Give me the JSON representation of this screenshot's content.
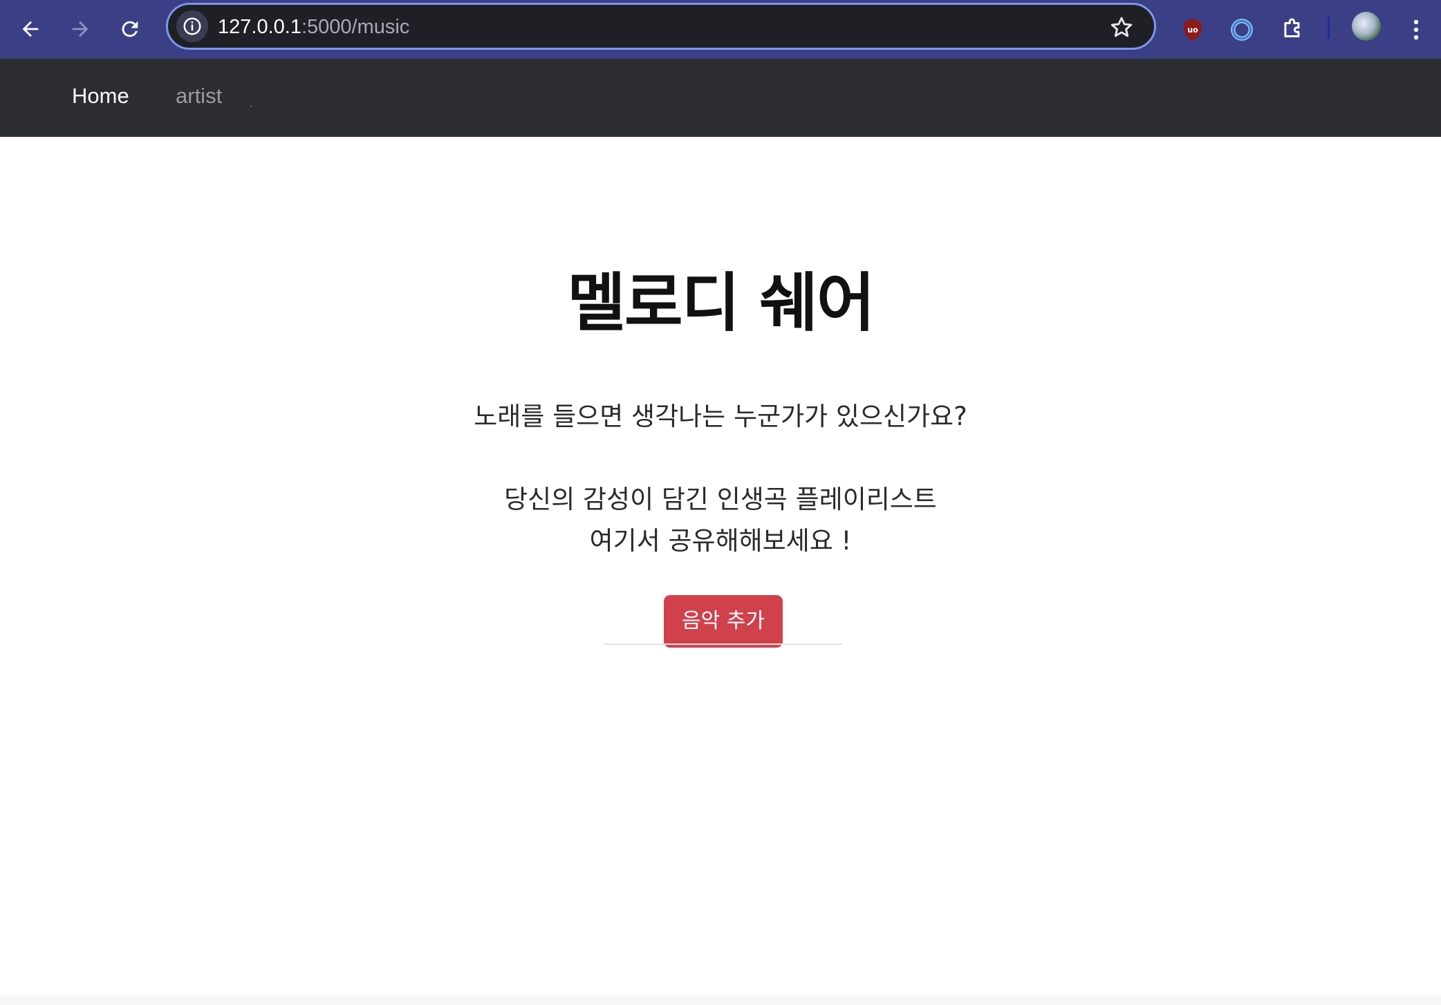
{
  "browser": {
    "url_host": "127.0.0.1",
    "url_path": ":5000/music",
    "icons": {
      "back": "arrow-left-icon",
      "forward": "arrow-right-icon",
      "reload": "reload-icon",
      "site_info": "info-icon",
      "bookmark": "star-icon",
      "ublock": "shield-icon",
      "extension_ring": "ring-icon",
      "extensions": "puzzle-icon",
      "profile": "avatar",
      "menu": "kebab-menu-icon"
    },
    "colors": {
      "chrome_bg": "#3b3f86",
      "omnibox_bg": "#1f2025",
      "omnibox_border": "#7d97ec"
    }
  },
  "navbar": {
    "home_label": "Home",
    "artist_label": "artist",
    "dot": ".",
    "colors": {
      "bg": "#2b2d31",
      "active": "#ffffff",
      "inactive": "#9a9ca1"
    }
  },
  "hero": {
    "title": "멜로디 쉐어",
    "line1": "노래를 들으면 생각나는 누군가가 있으신가요?",
    "line2": "당신의 감성이 담긴 인생곡 플레이리스트",
    "line3": "여기서 공유해해보세요 !",
    "add_button_label": "음악 추가",
    "colors": {
      "button_bg": "#d0414c",
      "button_text": "#ffffff"
    }
  }
}
